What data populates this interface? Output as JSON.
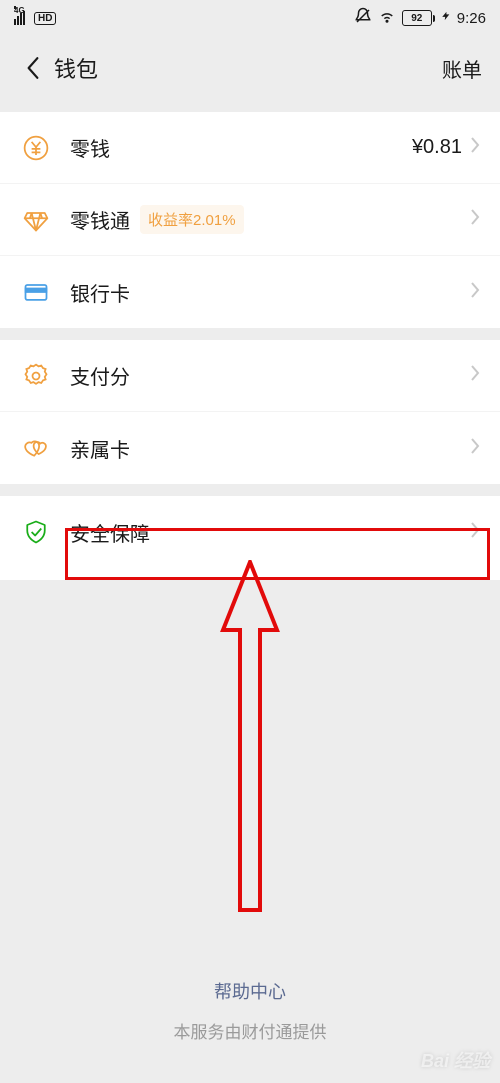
{
  "status": {
    "network_label": "4G",
    "hd": "HD",
    "battery_pct": "92",
    "time": "9:26"
  },
  "nav": {
    "title": "钱包",
    "right_label": "账单"
  },
  "cells": {
    "balance": {
      "title": "零钱",
      "value": "¥0.81"
    },
    "balance_plus": {
      "title": "零钱通",
      "tag": "收益率2.01%"
    },
    "card": {
      "title": "银行卡"
    },
    "payscore": {
      "title": "支付分"
    },
    "kincard": {
      "title": "亲属卡"
    },
    "security": {
      "title": "安全保障"
    }
  },
  "footer": {
    "help": "帮助中心",
    "provider": "本服务由财付通提供"
  },
  "watermark": {
    "brand": "Bai",
    "brand2": "经验",
    "sub": ""
  },
  "colors": {
    "highlight": "#e20b0b",
    "accent_yellow": "#f0a040",
    "shield_green": "#1aad19"
  }
}
